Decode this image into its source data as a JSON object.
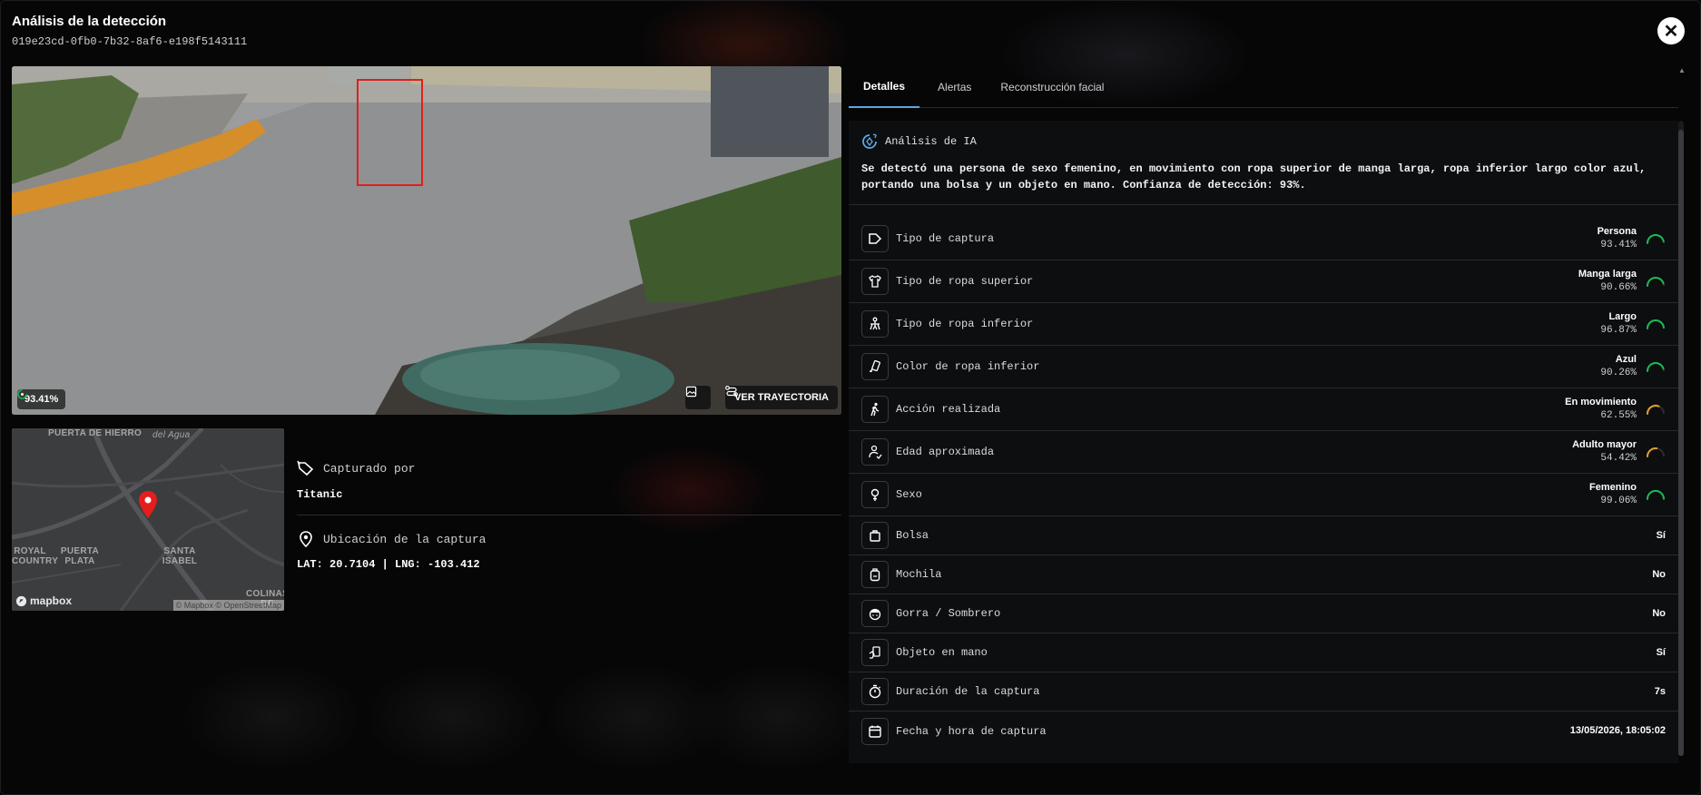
{
  "header": {
    "title": "Análisis de la detección",
    "id": "019e23cd-0fb0-7b32-8af6-e198f5143111",
    "close_icon": "close-icon"
  },
  "camera": {
    "confidence": "93.41%",
    "trajectory_label": "VER TRAYECTORIA",
    "bbox_color": "#e0201c"
  },
  "map": {
    "labels": [
      "PUERTA DE HIERRO",
      "del Agua",
      "ROYAL COUNTRY",
      "PUERTA PLATA",
      "SANTA ISABEL",
      "COLINAS DE"
    ],
    "brand": "mapbox",
    "attribution": "© Mapbox © OpenStreetMap",
    "pin_color": "#e41d1d"
  },
  "capture": {
    "captured_by_label": "Capturado por",
    "captured_by_value": "Titanic",
    "location_label": "Ubicación de la captura",
    "location_value": "LAT: 20.7104 | LNG: -103.412"
  },
  "tabs": [
    {
      "label": "Detalles",
      "active": true
    },
    {
      "label": "Alertas",
      "active": false
    },
    {
      "label": "Reconstrucción facial",
      "active": false
    }
  ],
  "ai": {
    "title": "Análisis de IA",
    "text": "Se detectó una persona de sexo femenino, en movimiento con ropa superior de manga larga, ropa inferior largo color azul, portando una bolsa y un objeto en mano. Confianza de detección: 93%."
  },
  "colors": {
    "gauge_high": "#1db954",
    "gauge_mid": "#e0a030",
    "accent": "#5aa8e6"
  },
  "attributes": [
    {
      "icon": "tag-icon",
      "label": "Tipo de captura",
      "value": "Persona",
      "pct": "93.41%",
      "level": 0.9341
    },
    {
      "icon": "shirt-icon",
      "label": "Tipo de ropa superior",
      "value": "Manga larga",
      "pct": "90.66%",
      "level": 0.9066
    },
    {
      "icon": "pants-icon",
      "label": "Tipo de ropa inferior",
      "value": "Largo",
      "pct": "96.87%",
      "level": 0.9687
    },
    {
      "icon": "color-palette-icon",
      "label": "Color de ropa inferior",
      "value": "Azul",
      "pct": "90.26%",
      "level": 0.9026
    },
    {
      "icon": "walking-icon",
      "label": "Acción realizada",
      "value": "En movimiento",
      "pct": "62.55%",
      "level": 0.6255
    },
    {
      "icon": "person-age-icon",
      "label": "Edad aproximada",
      "value": "Adulto mayor",
      "pct": "54.42%",
      "level": 0.5442
    },
    {
      "icon": "female-icon",
      "label": "Sexo",
      "value": "Femenino",
      "pct": "99.06%",
      "level": 0.9906
    }
  ],
  "simple_attributes": [
    {
      "icon": "bag-icon",
      "label": "Bolsa",
      "value": "Sí"
    },
    {
      "icon": "backpack-icon",
      "label": "Mochila",
      "value": "No"
    },
    {
      "icon": "hat-icon",
      "label": "Gorra / Sombrero",
      "value": "No"
    },
    {
      "icon": "hand-object-icon",
      "label": "Objeto en mano",
      "value": "Sí"
    },
    {
      "icon": "stopwatch-icon",
      "label": "Duración de la captura",
      "value": "7s"
    },
    {
      "icon": "calendar-icon",
      "label": "Fecha y hora de captura",
      "value": "13/05/2026, 18:05:02"
    }
  ]
}
